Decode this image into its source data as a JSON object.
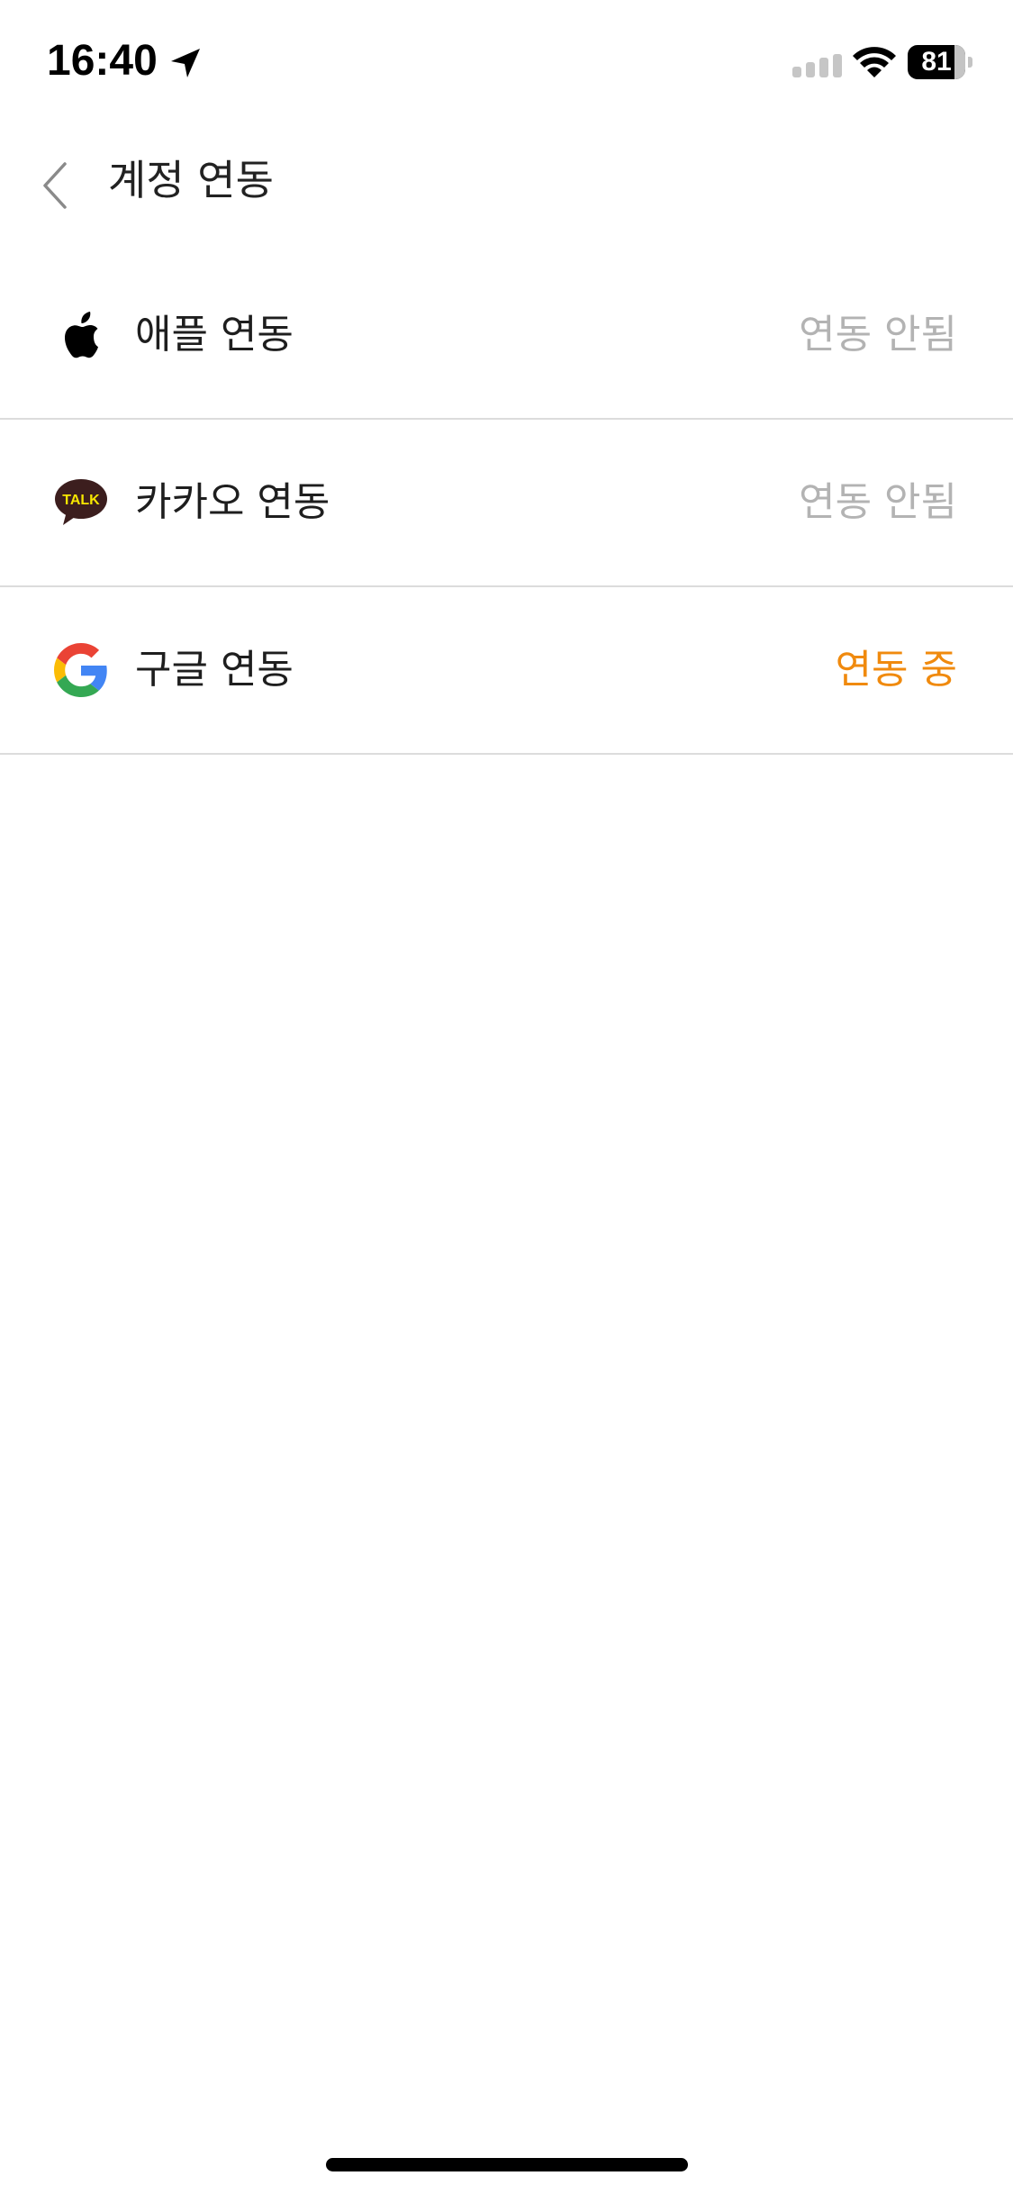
{
  "status_bar": {
    "time": "16:40",
    "battery_level": "81",
    "battery_fraction": 0.81
  },
  "header": {
    "title": "계정 연동",
    "back_icon": "chevron-left-icon"
  },
  "accounts": [
    {
      "label": "애플 연동",
      "status": "연동 안됨",
      "linked": false,
      "icon": "apple-icon"
    },
    {
      "label": "카카오 연동",
      "status": "연동 안됨",
      "linked": false,
      "icon": "kakao-talk-icon",
      "icon_text": "TALK"
    },
    {
      "label": "구글 연동",
      "status": "연동 중",
      "linked": true,
      "icon": "google-icon"
    }
  ],
  "colors": {
    "linked": "#f08a0e",
    "unlinked": "#b3b3b3",
    "divider": "#dcdcdc",
    "kakao_bubble": "#3c1e1e",
    "kakao_text": "#f7e600"
  }
}
